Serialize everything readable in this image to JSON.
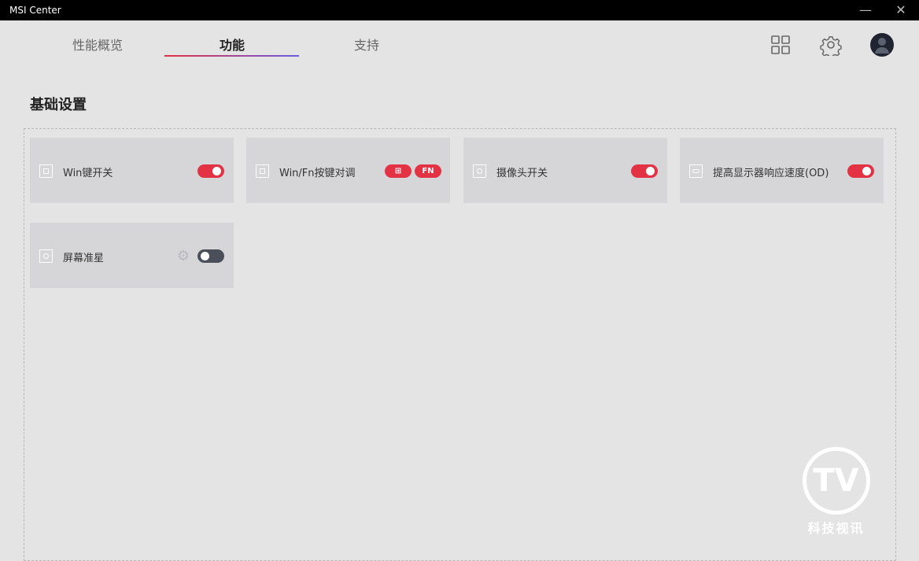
{
  "window": {
    "title": "MSI Center",
    "minimize": "—",
    "close": "✕"
  },
  "tabs": [
    {
      "label": "性能概览"
    },
    {
      "label": "功能",
      "active": true
    },
    {
      "label": "支持"
    }
  ],
  "toolbar_icons": [
    "grid-icon",
    "gear-icon",
    "avatar-icon"
  ],
  "section": {
    "title": "基础设置"
  },
  "cards": [
    {
      "label": "Win键开关",
      "toggle": true
    },
    {
      "label": "Win/Fn按键对调",
      "pills": [
        "⊞",
        "FN"
      ]
    },
    {
      "label": "摄像头开关",
      "toggle": true
    },
    {
      "label": "提高显示器响应速度(OD)",
      "toggle": true
    },
    {
      "label": "屏幕准星",
      "toggle": false,
      "settings": true
    }
  ],
  "colors": {
    "accent": "#e33244",
    "toggle_off": "#4a4f5a"
  },
  "watermark": {
    "text": "科技视讯",
    "logo": "TV"
  }
}
